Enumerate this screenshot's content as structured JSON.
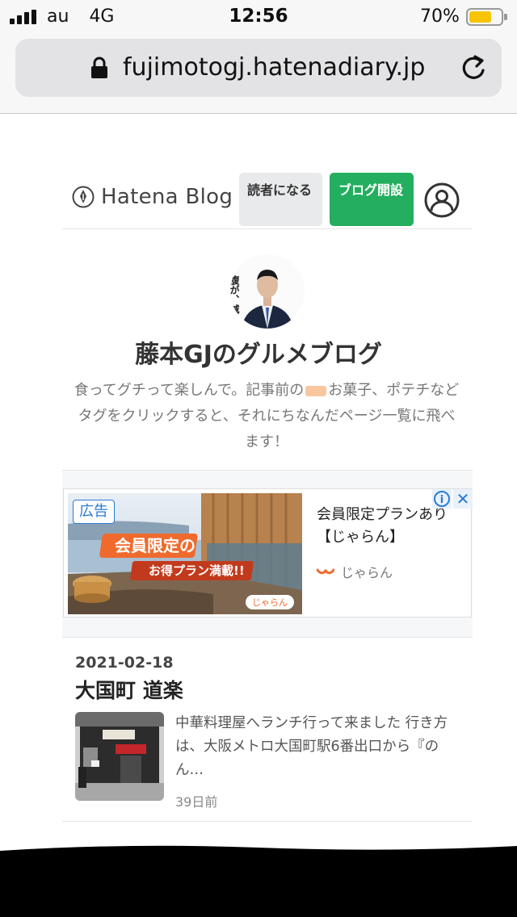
{
  "status_bar": {
    "carrier": "au",
    "network": "4G",
    "time": "12:56",
    "battery_percent": "70%",
    "battery_level": 0.7
  },
  "browser": {
    "url": "fujimotogj.hatenadiary.jp"
  },
  "hatena_header": {
    "logo_text": "Hatena Blog",
    "reader_button": "読者になる",
    "start_blog_button": "ブログ開設"
  },
  "profile": {
    "avatar_caption": "腹が、減った",
    "blog_title": "藤本GJのグルメブログ",
    "description_before": "食ってグチって楽しんで。記事前の",
    "description_after": "お菓子、ポテチなどタグをクリックすると、それにちなんだページ一覧に飛べます！"
  },
  "ad": {
    "label": "広告",
    "image_text_line1": "会員限定の",
    "image_text_line2": "お得プラン満載!!",
    "image_logo": "じゃらん",
    "title": "会員限定プランあり【じゃらん】",
    "brand": "じゃらん",
    "info_icon": "i",
    "close_icon": "✕"
  },
  "entry": {
    "date": "2021-02-18",
    "title": "大国町 道楽",
    "excerpt": "中華料理屋へランチ行って来ました 行き方は、大阪メトロ大国町駅6番出口から『のん…",
    "time_ago": "39日前"
  },
  "colors": {
    "accent_green": "#24ae5f",
    "ad_blue": "#2a7bd3",
    "battery_yellow": "#f8c300",
    "tag_orange": "#f9c79f"
  }
}
